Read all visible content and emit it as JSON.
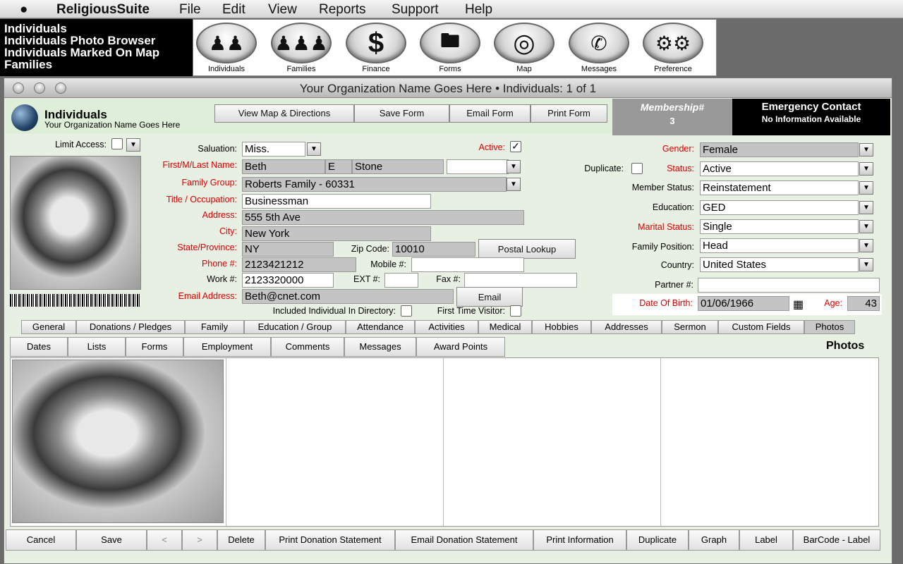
{
  "menubar": {
    "apple": "",
    "app": "ReligiousSuite",
    "items": [
      "File",
      "Edit",
      "View",
      "Reports",
      "Support",
      "Help"
    ]
  },
  "navlist": [
    "Individuals",
    "Individuals Photo Browser",
    "Individuals Marked On Map",
    "Families"
  ],
  "toolbar": [
    {
      "label": "Individuals",
      "icon": "people-icon"
    },
    {
      "label": "Families",
      "icon": "family-icon"
    },
    {
      "label": "Finance",
      "icon": "dollar-icon"
    },
    {
      "label": "Forms",
      "icon": "folder-icon"
    },
    {
      "label": "Map",
      "icon": "globe-icon"
    },
    {
      "label": "Messages",
      "icon": "phone-icon"
    },
    {
      "label": "Preference",
      "icon": "gears-icon"
    }
  ],
  "window": {
    "title": "Your Organization Name Goes Here  •  Individuals: 1 of 1"
  },
  "header": {
    "title": "Individuals",
    "subtitle": "Your Organization Name Goes Here",
    "buttons": [
      "View Map & Directions",
      "Save Form",
      "Email Form",
      "Print Form"
    ],
    "membership_label": "Membership#",
    "membership_value": "3",
    "emergency_title": "Emergency Contact",
    "emergency_info": "No Information Available"
  },
  "form": {
    "limit_access": "Limit Access:",
    "salutation_label": "Saluation:",
    "salutation": "Miss.",
    "active_label": "Active:",
    "active_check": "✓",
    "name_label": "First/M/Last Name:",
    "first": "Beth",
    "middle": "E",
    "last": "Stone",
    "family_label": "Family Group:",
    "family": "Roberts Family - 60331",
    "title_label": "Title / Occupation:",
    "title": "Businessman",
    "address_label": "Address:",
    "address": "555 5th Ave",
    "city_label": "City:",
    "city": "New York",
    "state_label": "State/Province:",
    "state": "NY",
    "zip_label": "Zip Code:",
    "zip": "10010",
    "postal_button": "Postal Lookup",
    "phone_label": "Phone #:",
    "phone": "2123421212",
    "mobile_label": "Mobile #:",
    "work_label": "Work #:",
    "work": "2123320000",
    "ext_label": "EXT #:",
    "fax_label": "Fax #:",
    "email_label": "Email Address:",
    "email": "Beth@cnet.com",
    "email_button": "Email",
    "directory_label": "Included Individual In Directory:",
    "firsttime_label": "First Time Visitor:",
    "duplicate_label": "Duplicate:",
    "gender_label": "Gender:",
    "gender": "Female",
    "status_label": "Status:",
    "status": "Active",
    "member_status_label": "Member Status:",
    "member_status": "Reinstatement",
    "education_label": "Education:",
    "education": "GED",
    "marital_label": "Marital Status:",
    "marital": "Single",
    "family_pos_label": "Family Position:",
    "family_pos": "Head",
    "country_label": "Country:",
    "country": "United States",
    "partner_label": "Partner #:",
    "dob_label": "Date Of Birth:",
    "dob": "01/06/1966",
    "age_label": "Age:",
    "age": "43"
  },
  "tabs": [
    "General",
    "Donations / Pledges",
    "Family",
    "Education / Group",
    "Attendance",
    "Activities",
    "Medical",
    "Hobbies",
    "Addresses",
    "Sermon",
    "Custom Fields",
    "Photos"
  ],
  "subtabs": [
    "Dates",
    "Lists",
    "Forms",
    "Employment",
    "Comments",
    "Messages",
    "Award Points"
  ],
  "photos_title": "Photos",
  "bottom": [
    "Cancel",
    "Save",
    "<",
    ">",
    "Delete",
    "Print Donation Statement",
    "Email Donation Statement",
    "Print Information",
    "Duplicate",
    "Graph",
    "Label",
    "BarCode - Label"
  ]
}
